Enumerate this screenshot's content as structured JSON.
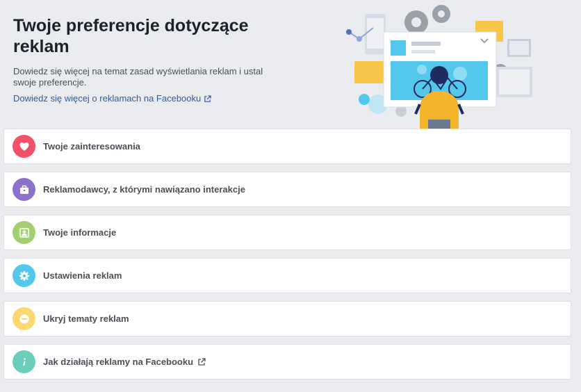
{
  "header": {
    "title": "Twoje preferencje dotyczące reklam",
    "description": "Dowiedz się więcej na temat zasad wyświetlania reklam i ustal swoje preferencje.",
    "learn_link": "Dowiedz się więcej o reklamach na Facebooku"
  },
  "items": [
    {
      "label": "Twoje zainteresowania",
      "icon": "heart-icon",
      "color": "#f25268"
    },
    {
      "label": "Reklamodawcy, z którymi nawiązano interakcje",
      "icon": "briefcase-icon",
      "color": "#8c72cb"
    },
    {
      "label": "Twoje informacje",
      "icon": "profile-card-icon",
      "color": "#a3ce71"
    },
    {
      "label": "Ustawienia reklam",
      "icon": "gear-icon",
      "color": "#54c7ec"
    },
    {
      "label": "Ukryj tematy reklam",
      "icon": "minus-circle-icon",
      "color": "#fcd872"
    },
    {
      "label": "Jak działają reklamy na Facebooku",
      "icon": "info-icon",
      "color": "#6bcebb"
    }
  ]
}
